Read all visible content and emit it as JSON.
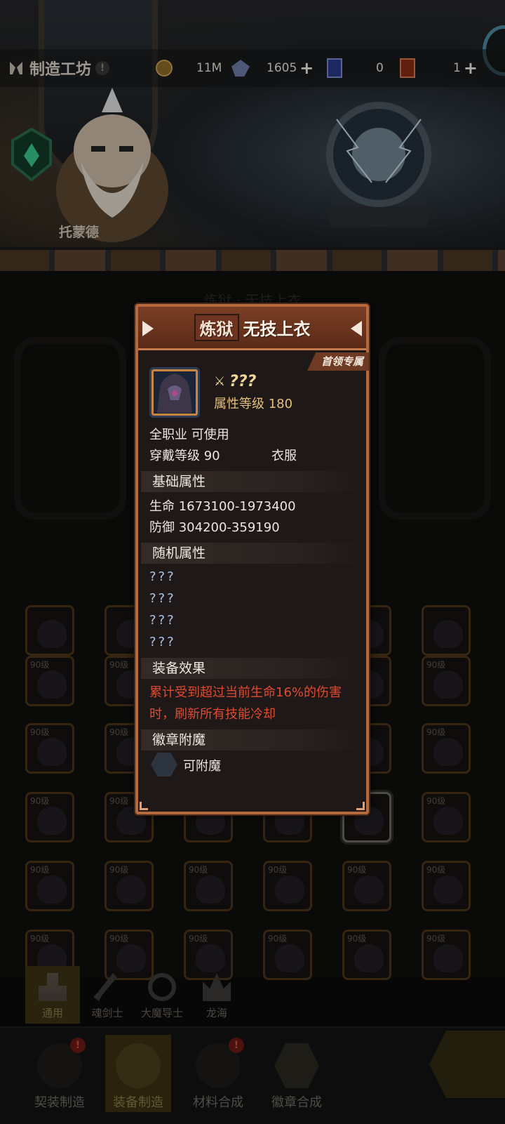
{
  "workshop": {
    "title": "制造工坊"
  },
  "resources": [
    {
      "name": "gold",
      "value": "11M",
      "has_plus": false
    },
    {
      "name": "crystal",
      "value": "1605",
      "has_plus": true
    },
    {
      "name": "clothing-scroll",
      "value": "0",
      "has_plus": false
    },
    {
      "name": "gold-scroll",
      "value": "1",
      "has_plus": true
    }
  ],
  "npc": {
    "name": "托蒙德"
  },
  "background": {
    "title": "炼狱 · 无技上衣"
  },
  "grid": {
    "level_label": "90级"
  },
  "modal": {
    "tier": "炼狱",
    "title": "无技上衣",
    "exclusive_tag": "首领专属",
    "item_name": "???",
    "attr_level": "属性等级 180",
    "usable": "全职业 可使用",
    "wear_level": "穿戴等级 90",
    "slot_type": "衣服",
    "base_header": "基础属性",
    "hp": "生命  1673100-1973400",
    "defense": "防御  304200-359190",
    "random_header": "随机属性",
    "random_attrs": [
      "???",
      "???",
      "???",
      "???"
    ],
    "effect_header": "装备效果",
    "effect_text": "累计受到超过当前生命16%的伤害时，刷新所有技能冷却",
    "badge_header": "徽章附魔",
    "enchantable": "可附魔"
  },
  "class_tabs": [
    {
      "label": "通用",
      "active": true
    },
    {
      "label": "魂剑士",
      "active": false
    },
    {
      "label": "大魔导士",
      "active": false
    },
    {
      "label": "龙海",
      "active": false
    }
  ],
  "bottom_nav": [
    {
      "label": "契装制造",
      "active": false,
      "alert": true
    },
    {
      "label": "装备制造",
      "active": true,
      "alert": false
    },
    {
      "label": "材料合成",
      "active": false,
      "alert": true
    },
    {
      "label": "徽章合成",
      "active": false,
      "alert": false
    }
  ],
  "colors": {
    "accent": "#b56a3e",
    "effect": "#e24a30",
    "gold": "#e4c07a",
    "unknown": "#aec6e6"
  }
}
